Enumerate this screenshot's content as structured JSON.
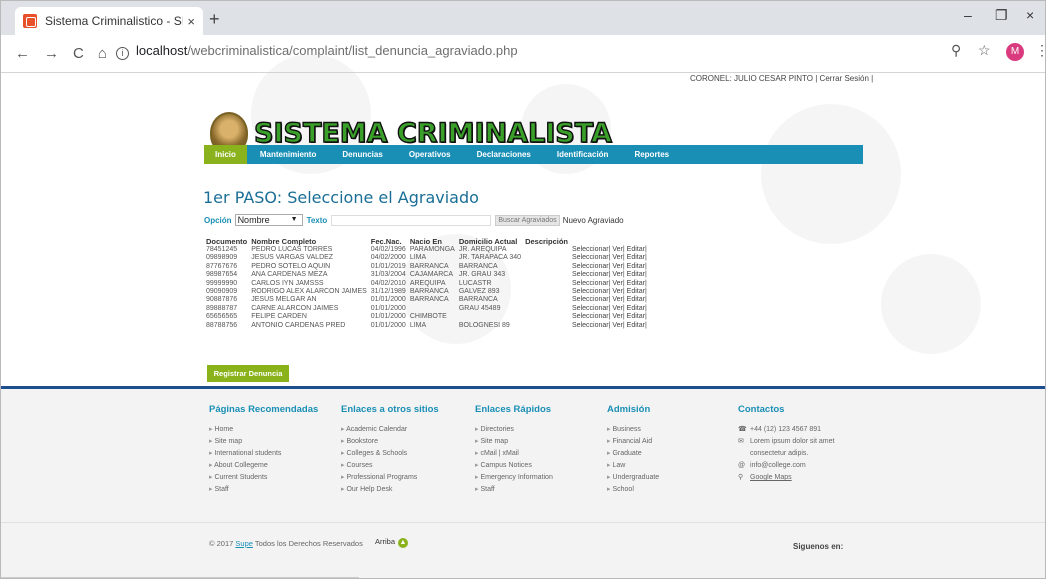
{
  "browser": {
    "tab_title": "Sistema Criminalistico - SISCrimi",
    "tab_close": "×",
    "new_tab": "+",
    "url_host": "localhost",
    "url_path": "/webcriminalistica/complaint/list_denuncia_agraviado.php",
    "profile_initial": "M",
    "back": "←",
    "forward": "→",
    "reload": "C",
    "home": "⌂",
    "zoom_icon": "⚲",
    "star_icon": "☆",
    "menu_icon": "⋮",
    "min": "–",
    "max": "❐",
    "close": "×"
  },
  "header": {
    "user": "CORONEL: JULIO CESAR PINTO",
    "sep1": "|",
    "logout": "Cerrar Sesión",
    "sep2": "|",
    "logo_text": "SISTEMA CRIMINALISTA"
  },
  "menu": [
    "Inicio",
    "Mantenimiento",
    "Denuncias",
    "Operativos",
    "Declaraciones",
    "Identificación",
    "Reportes"
  ],
  "main": {
    "title": "1er PASO: Seleccione el Agraviado",
    "option_label": "Opción",
    "option_value": "Nombre",
    "text_label": "Texto",
    "search_btn": "Buscar Agraviados",
    "new_link": "Nuevo Agraviado",
    "register_btn": "Registrar Denuncia"
  },
  "table": {
    "headers": [
      "Documento",
      "Nombre Completo",
      "Fec.Nac.",
      "Nacio En",
      "Domicilio Actual",
      "Descripción"
    ],
    "actions": [
      "Seleccionar|",
      "Ver|",
      "Editar|"
    ],
    "rows": [
      [
        "78451245",
        "PEDRO LUCAS TORRES",
        "04/02/1996",
        "PARAMONGA",
        "JR. AREQUIPA",
        ""
      ],
      [
        "09898909",
        "JESUS VARGAS VALDEZ",
        "04/02/2000",
        "LIMA",
        "JR. TARAPACA 340",
        ""
      ],
      [
        "87767676",
        "PEDRO SOTELO AQUIN",
        "01/01/2019",
        "BARRANCA",
        "BARRANCA",
        ""
      ],
      [
        "98987654",
        "ANA CARDENAS MEZA",
        "31/03/2004",
        "CAJAMARCA",
        "JR. GRAU 343",
        ""
      ],
      [
        "99999990",
        "CARLOS IYN JAMSSS",
        "04/02/2010",
        "AREQUIPA",
        "LUCASTR",
        ""
      ],
      [
        "09090909",
        "RODRIGO ALEX ALARCON JAIMES",
        "31/12/1989",
        "BARRANCA",
        "GALVEZ 893",
        ""
      ],
      [
        "90887876",
        "JESUS MELGAR AN",
        "01/01/2000",
        "BARRANCA",
        "BARRANCA",
        ""
      ],
      [
        "89888787",
        "CARNE ALARCON JAIMES",
        "01/01/2000",
        "",
        "GRAU 45489",
        ""
      ],
      [
        "65656565",
        "FELIPE CARDEN",
        "01/01/2000",
        "CHIMBOTE",
        "",
        ""
      ],
      [
        "88788756",
        "ANTONIO CARDENAS PRED",
        "01/01/2000",
        "LIMA",
        "BOLOGNESI 89",
        ""
      ]
    ]
  },
  "footer": {
    "cols": [
      {
        "title": "Páginas Recomendadas",
        "links": [
          "Home",
          "Site map",
          "International students",
          "About Collegeme",
          "Current Students",
          "Staff"
        ]
      },
      {
        "title": "Enlaces a otros sitios",
        "links": [
          "Academic Calendar",
          "Bookstore",
          "Colleges & Schools",
          "Courses",
          "Professional Programs",
          "Our Help Desk"
        ]
      },
      {
        "title": "Enlaces Rápidos",
        "links": [
          "Directories",
          "Site map",
          "cMail | xMail",
          "Campus Notices",
          "Emergency Information",
          "Staff"
        ]
      },
      {
        "title": "Admisión",
        "links": [
          "Business",
          "Financial Aid",
          "Graduate",
          "Law",
          "Undergraduate",
          "School"
        ]
      }
    ],
    "contacts_title": "Contactos",
    "phone": "+44 (12) 123 4567 891",
    "address_1": "Lorem ipsum dolor sit amet",
    "address_2": "consectetur adipis.",
    "email": "info@college.com",
    "maps": "Google Maps",
    "copy_prefix": "© 2017",
    "copy_brand": "Supe",
    "copy_suffix": "Todos los Derechos Reservados",
    "arriba": "Arriba",
    "siguenos": "Siguenos en:"
  },
  "colors": {
    "menu_bg": "#1a8fb6",
    "active": "#89b21c",
    "title": "#1a6e96",
    "logo": "#3aa02a"
  }
}
